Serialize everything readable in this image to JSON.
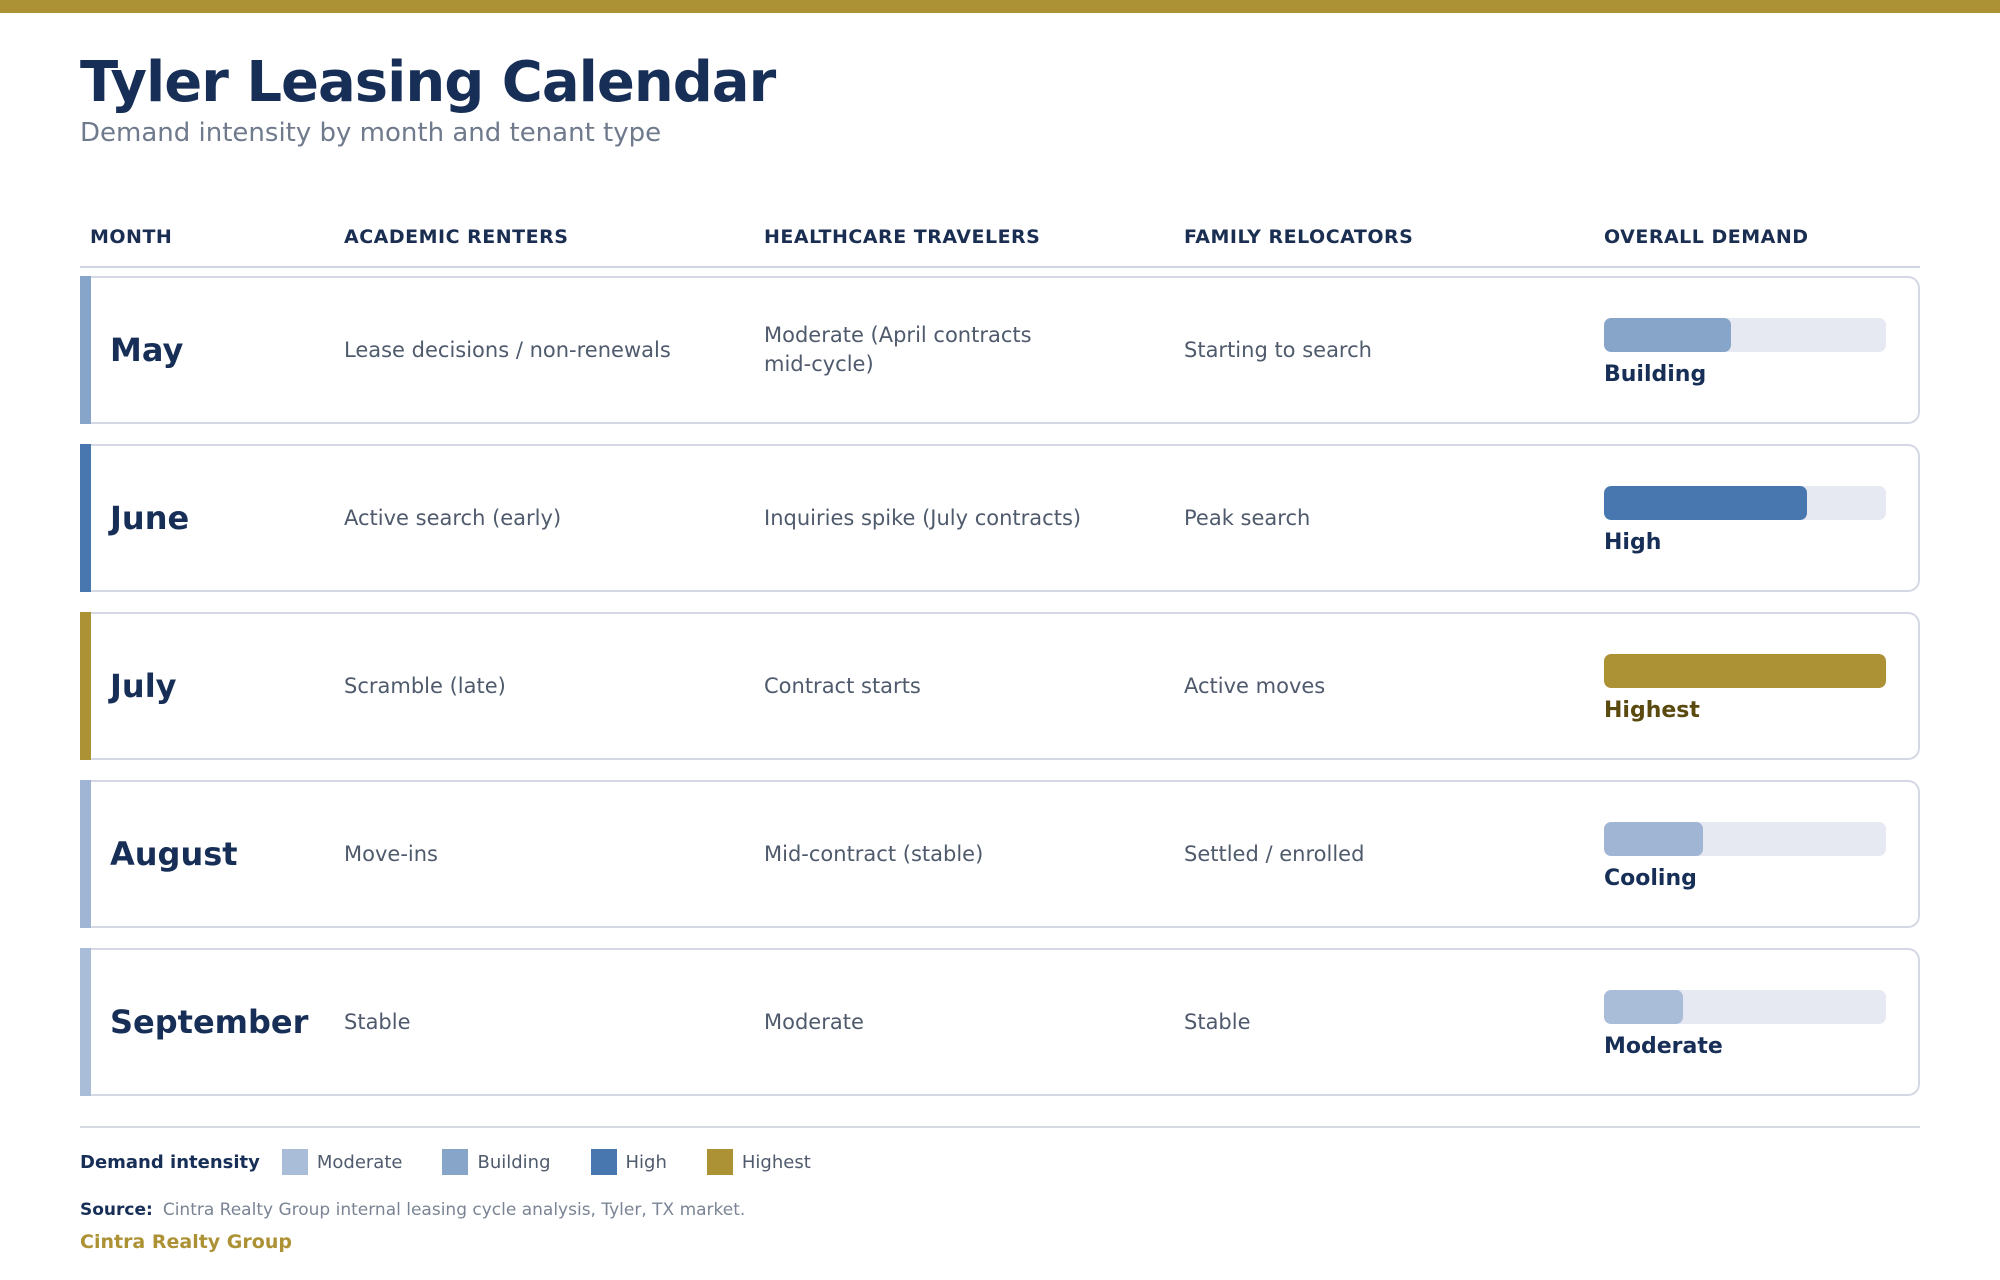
{
  "header": {
    "title": "Tyler Leasing Calendar",
    "subtitle": "Demand intensity by month and tenant type"
  },
  "table": {
    "columns": [
      "MONTH",
      "ACADEMIC RENTERS",
      "HEALTHCARE TRAVELERS",
      "FAMILY RELOCATORS",
      "OVERALL DEMAND"
    ],
    "rows": [
      {
        "month": "May",
        "academic": "Lease decisions / non-renewals",
        "healthcare": "Moderate (April contracts mid-cycle)",
        "family": "Starting to search",
        "demand": "Building",
        "level_pct": 45,
        "color": "#87a4c9",
        "label_color": "#172f57"
      },
      {
        "month": "June",
        "academic": "Active search (early)",
        "healthcare": "Inquiries spike (July contracts)",
        "family": "Peak search",
        "demand": "High",
        "level_pct": 72,
        "color": "#4877b0",
        "label_color": "#172f57"
      },
      {
        "month": "July",
        "academic": "Scramble (late)",
        "healthcare": "Contract starts",
        "family": "Active moves",
        "demand": "Highest",
        "level_pct": 100,
        "color": "#ad9235",
        "label_color": "#5a4a10"
      },
      {
        "month": "August",
        "academic": "Move-ins",
        "healthcare": "Mid-contract (stable)",
        "family": "Settled / enrolled",
        "demand": "Cooling",
        "level_pct": 35,
        "color": "#9fb5d3",
        "label_color": "#172f57"
      },
      {
        "month": "September",
        "academic": "Stable",
        "healthcare": "Moderate",
        "family": "Stable",
        "demand": "Moderate",
        "level_pct": 28,
        "color": "#a9bdd8",
        "label_color": "#172f57"
      }
    ]
  },
  "legend": {
    "title": "Demand intensity",
    "items": [
      {
        "label": "Moderate",
        "color": "#a9bdd8"
      },
      {
        "label": "Building",
        "color": "#87a4c9"
      },
      {
        "label": "High",
        "color": "#4877b0"
      },
      {
        "label": "Highest",
        "color": "#ad9235"
      }
    ]
  },
  "footer": {
    "source_label": "Source:",
    "source_text": "Cintra Realty Group internal leasing cycle analysis, Tyler, TX market.",
    "brand": "Cintra Realty Group"
  }
}
